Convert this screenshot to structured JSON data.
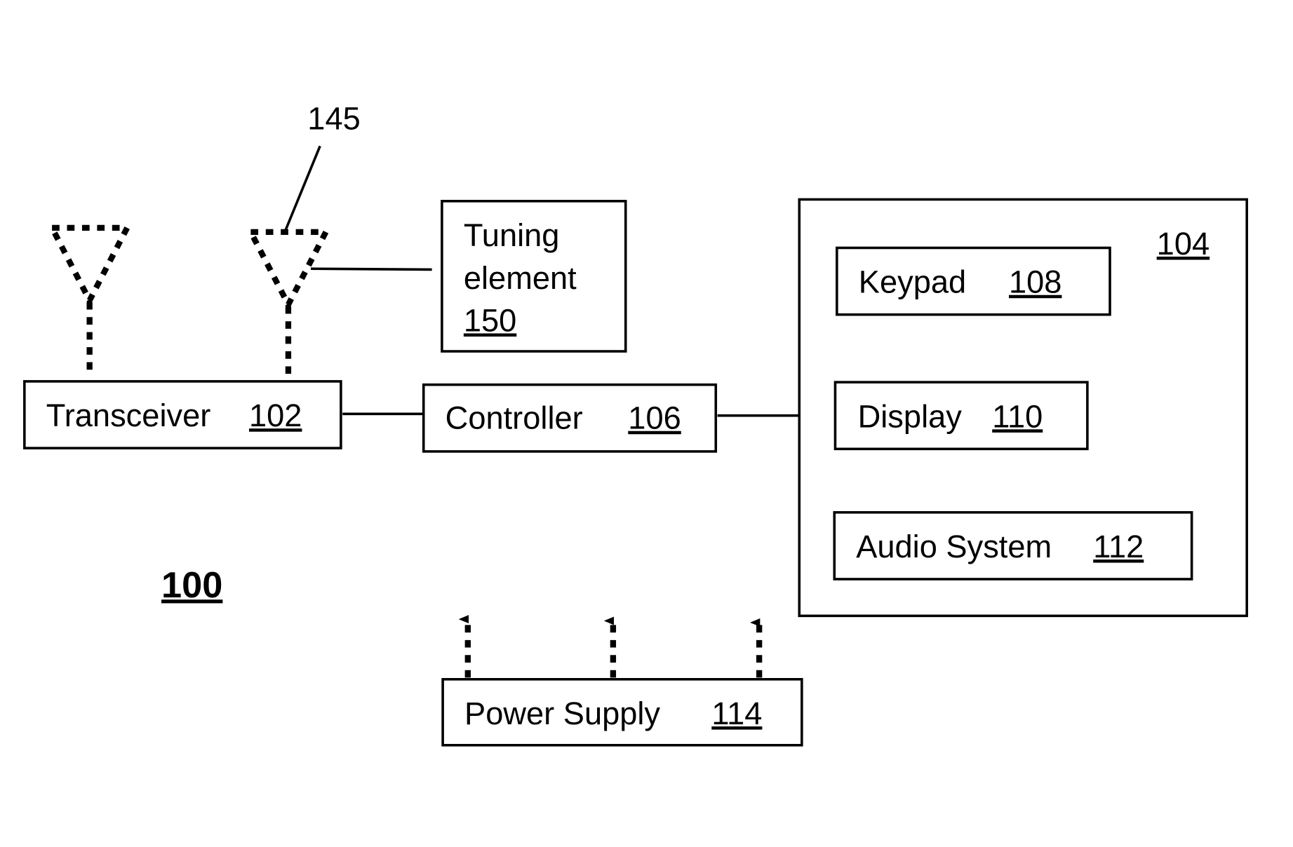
{
  "figure": {
    "figure_ref": "100",
    "antenna_ref": "145",
    "tuning": {
      "line1": "Tuning",
      "line2": "element",
      "ref": "150"
    },
    "transceiver": {
      "label": "Transceiver",
      "ref": "102"
    },
    "controller": {
      "label": "Controller",
      "ref": "106"
    },
    "ui_group": {
      "ref": "104"
    },
    "keypad": {
      "label": "Keypad",
      "ref": "108"
    },
    "display": {
      "label": "Display",
      "ref": "110"
    },
    "audio": {
      "label": "Audio System",
      "ref": "112"
    },
    "power": {
      "label": "Power Supply",
      "ref": "114"
    }
  }
}
